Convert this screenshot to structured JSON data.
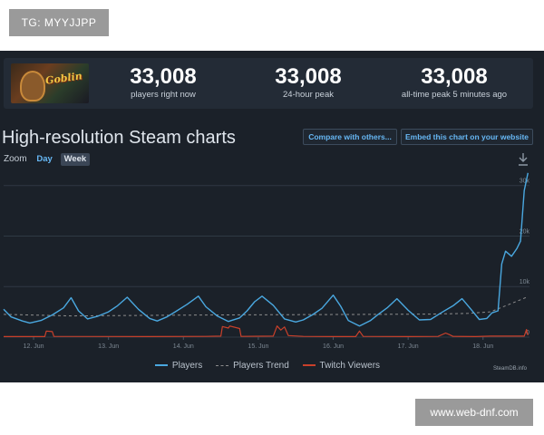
{
  "watermark_top": "TG: MYYJJPP",
  "watermark_bottom": "www.web-dnf.com",
  "stats": [
    {
      "value": "33,008",
      "label": "players right now"
    },
    {
      "value": "33,008",
      "label": "24-hour peak"
    },
    {
      "value": "33,008",
      "label": "all-time peak 5 minutes ago"
    }
  ],
  "chart_title": "High-resolution Steam charts",
  "buttons": {
    "compare": "Compare with others...",
    "embed": "Embed this chart on your website"
  },
  "zoom": {
    "label": "Zoom",
    "options": [
      "Day",
      "Week"
    ],
    "selected": "Day"
  },
  "icons": {
    "download": "download-icon",
    "game": "game-thumbnail"
  },
  "legend": [
    "Players",
    "Players Trend",
    "Twitch Viewers"
  ],
  "credit": "SteamDB.info",
  "colors": {
    "players": "#4aa8e0",
    "trend": "#8d8d8d",
    "twitch": "#c9402a",
    "accent": "#67b8f5",
    "panel_bg": "#1b2129"
  },
  "chart_data": {
    "type": "line",
    "x_ticks": [
      "12. Jun",
      "13. Jun",
      "14. Jun",
      "15. Jun",
      "16. Jun",
      "17. Jun",
      "18. Jun"
    ],
    "y_ticks": [
      "0",
      "10k",
      "20k",
      "30k"
    ],
    "ylim": [
      0,
      33000
    ],
    "x_range": [
      11.6,
      18.62
    ],
    "series": [
      {
        "name": "Players",
        "x": [
          11.6,
          11.7,
          11.85,
          11.95,
          12.1,
          12.25,
          12.4,
          12.5,
          12.6,
          12.72,
          12.85,
          13.0,
          13.12,
          13.25,
          13.4,
          13.55,
          13.65,
          13.78,
          13.9,
          14.05,
          14.2,
          14.3,
          14.45,
          14.6,
          14.75,
          14.85,
          14.95,
          15.05,
          15.2,
          15.35,
          15.5,
          15.6,
          15.72,
          15.85,
          16.0,
          16.1,
          16.2,
          16.35,
          16.5,
          16.6,
          16.72,
          16.85,
          17.0,
          17.15,
          17.3,
          17.45,
          17.6,
          17.72,
          17.85,
          17.95,
          18.05,
          18.12,
          18.2,
          18.25,
          18.3,
          18.38,
          18.45,
          18.5,
          18.55,
          18.6
        ],
        "values": [
          5500,
          4000,
          3200,
          2800,
          3300,
          4400,
          5800,
          7800,
          5200,
          3600,
          4100,
          5000,
          6200,
          7900,
          5500,
          3700,
          3200,
          4000,
          5100,
          6500,
          8100,
          6000,
          4200,
          3100,
          3800,
          5200,
          7000,
          8100,
          6300,
          3600,
          3000,
          3400,
          4400,
          5700,
          8300,
          6100,
          3300,
          2200,
          3300,
          4500,
          5800,
          7600,
          5300,
          3400,
          3500,
          4900,
          6200,
          7600,
          5300,
          3500,
          3700,
          4800,
          5200,
          14500,
          17000,
          16000,
          17500,
          19000,
          29000,
          32500
        ]
      },
      {
        "name": "Players Trend",
        "x": [
          11.6,
          12.5,
          13.5,
          14.5,
          15.5,
          16.5,
          17.3,
          17.8,
          18.1,
          18.35,
          18.6
        ],
        "values": [
          4500,
          4200,
          4300,
          4400,
          4450,
          4500,
          4550,
          4700,
          5000,
          6500,
          8000
        ]
      },
      {
        "name": "Twitch Viewers",
        "x": [
          11.6,
          12.15,
          12.17,
          12.25,
          12.27,
          13.5,
          14.3,
          14.5,
          14.52,
          14.6,
          14.62,
          14.75,
          14.77,
          15.2,
          15.25,
          15.3,
          15.35,
          15.4,
          15.6,
          16.0,
          16.3,
          16.35,
          16.4,
          17.0,
          17.4,
          17.5,
          17.55,
          17.6,
          17.9,
          18.1,
          18.55,
          18.58,
          18.6
        ],
        "values": [
          100,
          100,
          1200,
          1100,
          150,
          100,
          150,
          200,
          2100,
          1800,
          2200,
          1700,
          150,
          200,
          2200,
          1400,
          2000,
          300,
          150,
          100,
          100,
          1200,
          150,
          100,
          150,
          800,
          500,
          150,
          100,
          200,
          200,
          1500,
          400
        ]
      }
    ]
  }
}
